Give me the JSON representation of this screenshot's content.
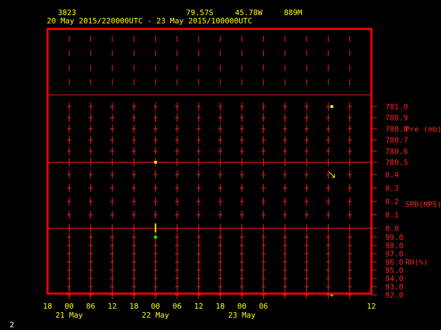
{
  "header": {
    "station_id": "3823",
    "lat": "79.57S",
    "lon": "45.78W",
    "elev": "889M",
    "time_range": "20 May 2015/220000UTC - 23 May 2015/100000UTC"
  },
  "page_number": "2",
  "colors": {
    "frame": "#ff0000",
    "grid": "#ff2020",
    "axis_text": "#ffff00",
    "label_text": "#ff2020",
    "point_yellow": "#ffff00",
    "point_green": "#00ff00",
    "background": "#000000"
  },
  "chart_data": [
    {
      "type": "scatter",
      "panel": "top",
      "title": "",
      "series": [],
      "grid": true
    },
    {
      "type": "scatter",
      "panel": "pressure",
      "ylabel": "Pre (mb)",
      "y_ticks": [
        "781.0",
        "780.9",
        "780.8",
        "780.7",
        "780.6",
        "780.5"
      ],
      "ylim": [
        780.5,
        781.0
      ],
      "points": [
        {
          "t": 30,
          "value": 780.5,
          "color": "#ffff00"
        },
        {
          "t": 79,
          "value": 781.0,
          "color": "#ffff00"
        }
      ],
      "grid": true
    },
    {
      "type": "scatter",
      "panel": "wind",
      "ylabel": "SPD(MPS)",
      "y_ticks": [
        "0.4",
        "0.3",
        "0.2",
        "0.1",
        "0.0"
      ],
      "ylim": [
        0.0,
        0.5
      ],
      "points": [
        {
          "t": 30,
          "value": 0.0,
          "color": "#ffff00",
          "marker": "bar"
        },
        {
          "t": 79,
          "value": 0.4,
          "color": "#ffff00",
          "marker": "arrow"
        }
      ],
      "grid": true
    },
    {
      "type": "scatter",
      "panel": "humidity",
      "ylabel": "RH(%)",
      "y_ticks": [
        "99.0",
        "98.0",
        "97.0",
        "96.0",
        "95.0",
        "94.0",
        "93.0",
        "92.0"
      ],
      "ylim": [
        92.0,
        99.0
      ],
      "points": [
        {
          "t": 30,
          "value": 99.0,
          "color": "#00ff00"
        },
        {
          "t": 79,
          "value": 92.0,
          "color": "#00ff00"
        }
      ],
      "grid": true
    }
  ],
  "x_axis": {
    "hour_ticks": [
      "18",
      "00",
      "06",
      "12",
      "18",
      "00",
      "06",
      "12",
      "18",
      "00",
      "06",
      "12"
    ],
    "day_labels": [
      "21 May",
      "22 May",
      "23 May"
    ],
    "xlim_hours": [
      0,
      90
    ]
  }
}
